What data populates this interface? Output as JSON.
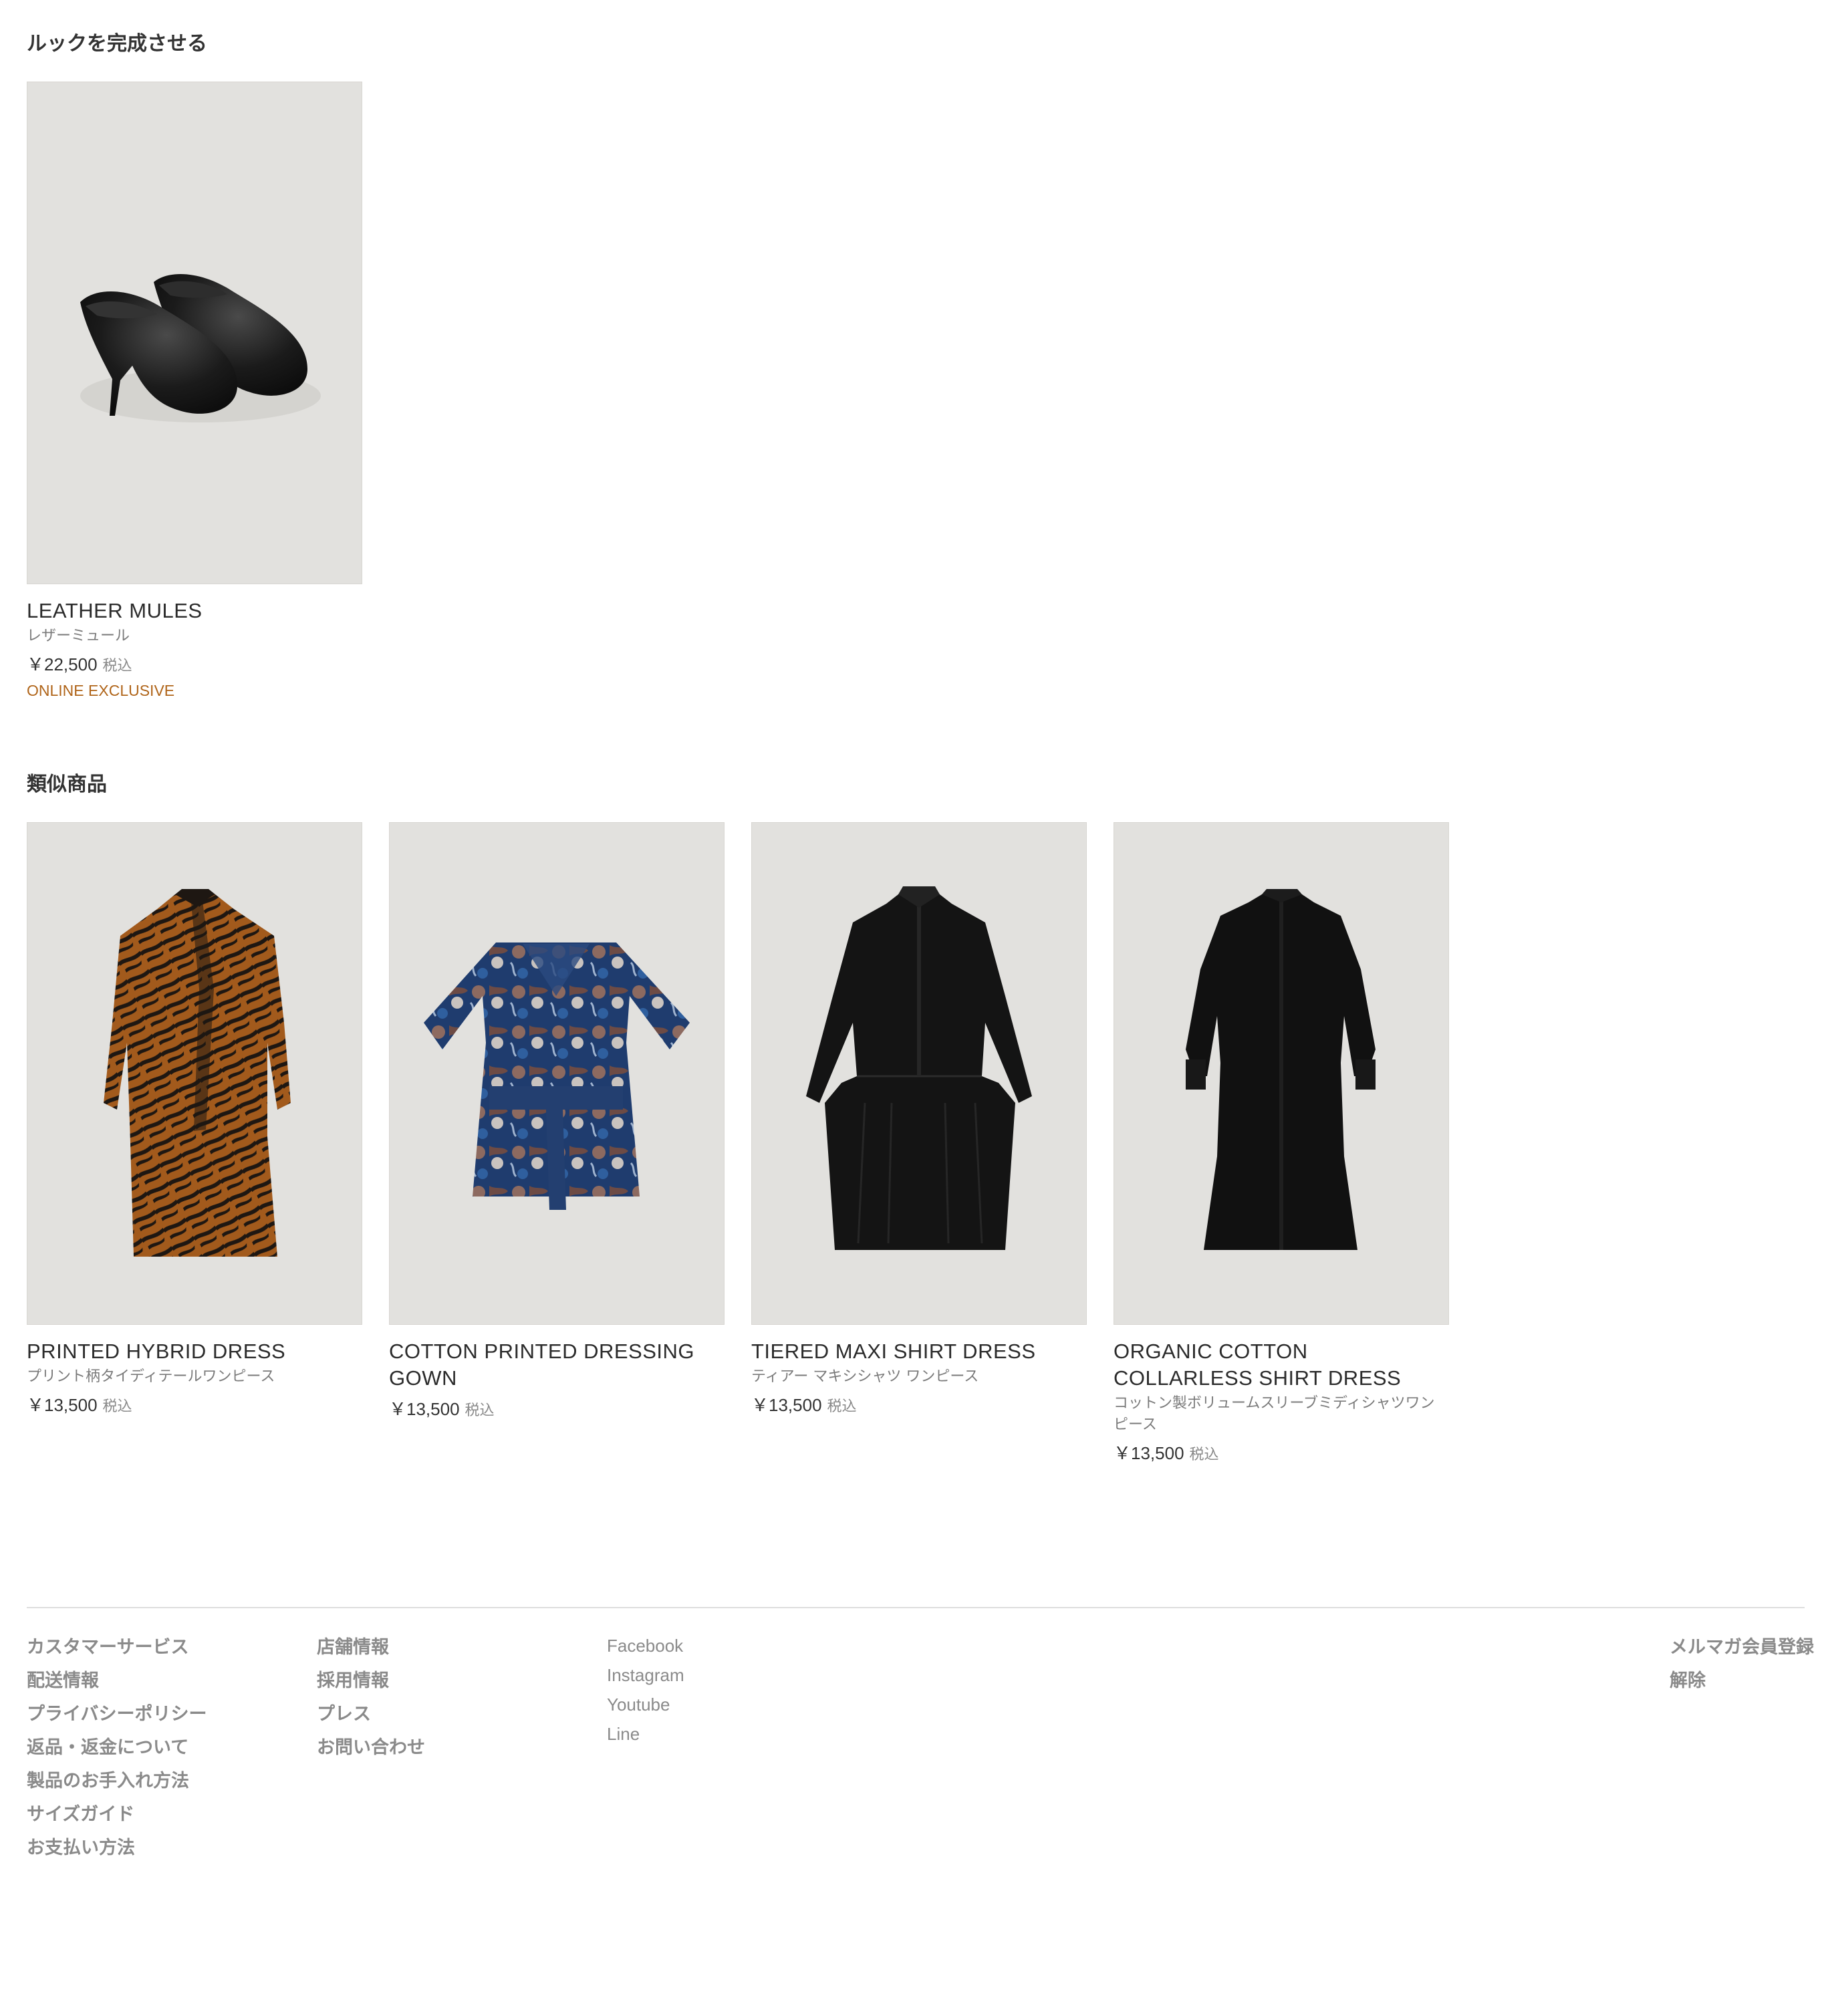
{
  "complete_look": {
    "title": "ルックを完成させる",
    "products": [
      {
        "name": "LEATHER MULES",
        "subtitle": "レザーミュール",
        "price": "￥22,500",
        "tax": "税込",
        "badge": "ONLINE EXCLUSIVE",
        "image": "black-leather-mules"
      }
    ]
  },
  "similar": {
    "title": "類似商品",
    "products": [
      {
        "name": "PRINTED HYBRID DRESS",
        "subtitle": "プリント柄タイディテールワンピース",
        "price": "￥13,500",
        "tax": "税込",
        "image": "brown-tiger-print-dress"
      },
      {
        "name": "COTTON PRINTED DRESSING GOWN",
        "subtitle": "",
        "price": "￥13,500",
        "tax": "税込",
        "image": "blue-printed-dressing-gown"
      },
      {
        "name": "TIERED MAXI SHIRT DRESS",
        "subtitle": "ティアー マキシシャツ ワンピース",
        "price": "￥13,500",
        "tax": "税込",
        "image": "black-tiered-shirt-dress"
      },
      {
        "name": "ORGANIC COTTON COLLARLESS SHIRT DRESS",
        "subtitle": "コットン製ボリュームスリーブミディシャツワンピース",
        "price": "￥13,500",
        "tax": "税込",
        "image": "black-collarless-shirt-dress"
      }
    ]
  },
  "footer": {
    "customer_links": [
      "カスタマーサービス",
      "配送情報",
      "プライバシーポリシー",
      "返品・返金について",
      "製品のお手入れ方法",
      "サイズガイド",
      "お支払い方法"
    ],
    "store_links": [
      "店舗情報",
      "採用情報",
      "プレス",
      "お問い合わせ"
    ],
    "social_links": [
      "Facebook",
      "Instagram",
      "Youtube",
      "Line"
    ],
    "newsletter_links": [
      "メルマガ会員登録",
      "解除"
    ]
  },
  "colors": {
    "badge": "#b0651a",
    "image_bg": "#e2e1de",
    "footer_link": "#8a8a8a"
  }
}
